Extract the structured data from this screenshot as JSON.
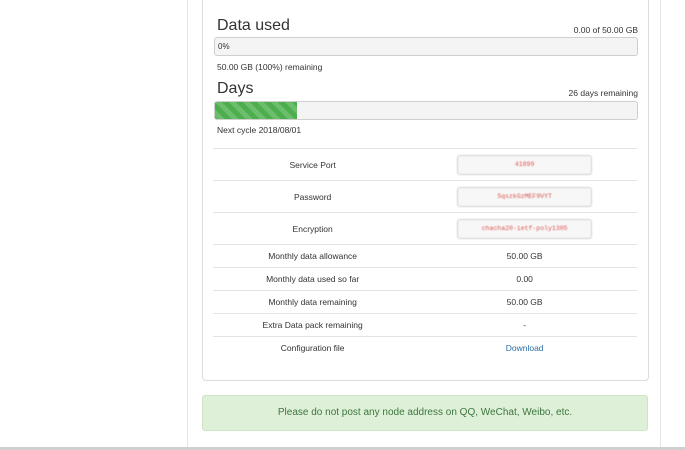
{
  "data_used": {
    "title": "Data used",
    "summary": "0.00 of 50.00 GB",
    "progress_text": "0%",
    "progress_fraction": 0.0,
    "remaining_text": "50.00 GB (100%) remaining"
  },
  "days": {
    "title": "Days",
    "summary": "26 days remaining",
    "progress_fraction": 0.195,
    "next_cycle": "Next cycle 2018/08/01"
  },
  "details": {
    "service_port": {
      "label": "Service Port",
      "value": "41899"
    },
    "password": {
      "label": "Password",
      "value": "5qszkGzMEF9VYT"
    },
    "encryption": {
      "label": "Encryption",
      "value": "chacha20-ietf-poly1305"
    },
    "monthly_allowance": {
      "label": "Monthly data allowance",
      "value": "50.00 GB"
    },
    "used_so_far": {
      "label": "Monthly data used so far",
      "value": "0.00"
    },
    "monthly_remaining": {
      "label": "Monthly data remaining",
      "value": "50.00 GB"
    },
    "extra_pack": {
      "label": "Extra Data pack remaining",
      "value": "-"
    },
    "config_file": {
      "label": "Configuration file",
      "value": "Download"
    }
  },
  "notice": "Please do not post any node address on QQ, WeChat, Weibo, etc.",
  "colors": {
    "progress_green": "#4cae4c",
    "notice_bg": "#dff0d8",
    "notice_text": "#3c763d",
    "link": "#2a6fa8",
    "masked_text": "#d9534f"
  }
}
